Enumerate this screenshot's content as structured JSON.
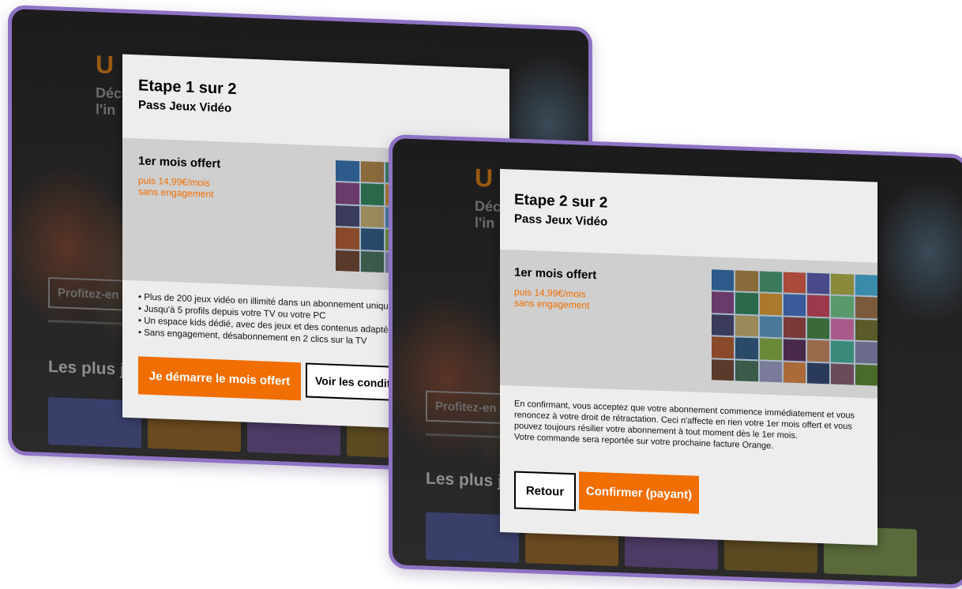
{
  "background_app": {
    "hero_title_fragment": "U",
    "hero_sub_fragment_1": "Déc",
    "hero_sub_fragment_2": "l'in",
    "cta_label": "Profitez-en",
    "section_title": "Les plus j"
  },
  "dialog_step1": {
    "step": "Etape 1 sur 2",
    "title": "Pass Jeux Vidéo",
    "offer_head": "1er mois offert",
    "price_line_1": "puis 14,99€/mois",
    "price_line_2": "sans engagement",
    "benefits": [
      "Plus de 200 jeux vidéo en illimité dans un abonnement unique",
      "Jusqu'à 5 profils depuis votre TV ou votre PC",
      "Un espace kids dédié, avec des jeux et des contenus adaptés",
      "Sans engagement, désabonnement en 2 clics sur la TV"
    ],
    "primary_button": "Je démarre  le mois offert",
    "secondary_button": "Voir les conditions"
  },
  "dialog_step2": {
    "step": "Etape 2 sur 2",
    "title": "Pass Jeux Vidéo",
    "offer_head": "1er mois offert",
    "price_line_1": "puis 14,99€/mois",
    "price_line_2": "sans engagement",
    "legal_line_1": "En confirmant, vous acceptez que votre abonnement commence immédiatement et vous",
    "legal_line_2": "renoncez à votre droit de rétractation. Ceci n'affecte en rien votre 1er mois offert et vous",
    "legal_line_3": "pouvez toujours résilier votre abonnement à tout moment dès le 1er mois.",
    "legal_line_4": "Votre commande sera reportée sur votre prochaine facture Orange.",
    "back_button": "Retour",
    "confirm_button": "Confirmer (payant)"
  },
  "colors": {
    "accent": "#f16e00",
    "frame": "#8e73c4",
    "dialog_bg": "#ededed",
    "offer_band": "#cfcfcf"
  }
}
